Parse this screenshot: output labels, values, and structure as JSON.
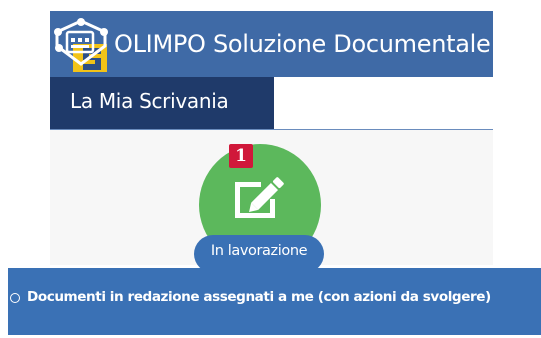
{
  "header": {
    "app_title": "OLIMPO Soluzione Documentale",
    "logo_icon": "olimpo-logo",
    "background": "#3f6aa6"
  },
  "nav": {
    "active_tab": "La Mia Scrivania",
    "tab_background": "#1f3a6a"
  },
  "tile": {
    "badge_count": "1",
    "label": "In lavorazione",
    "icon": "edit-icon",
    "circle_color": "#5cb85c",
    "badge_color": "#d0183a"
  },
  "section": {
    "title": "Documenti in redazione assegnati a me (con azioni da svolgere)",
    "background": "#3a71b5"
  }
}
